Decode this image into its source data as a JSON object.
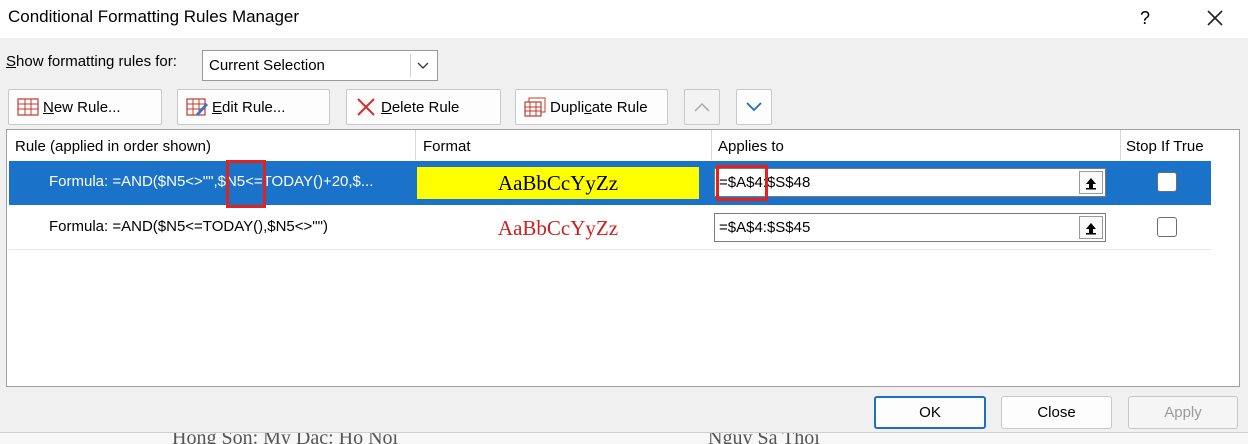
{
  "dialog": {
    "title": "Conditional Formatting Rules Manager",
    "help_label": "?",
    "close_icon": "close-x-icon"
  },
  "show_rules": {
    "label_mnemonic": "S",
    "label_rest": "how formatting rules for:",
    "selected": "Current Selection"
  },
  "toolbar": {
    "new_rule": {
      "pre": "",
      "mn": "N",
      "post": "ew Rule..."
    },
    "edit_rule": {
      "pre": "",
      "mn": "E",
      "post": "dit Rule..."
    },
    "delete_rule": {
      "pre": "",
      "mn": "D",
      "post": "elete Rule"
    },
    "duplicate_rule": {
      "pre": "Dupli",
      "mn": "c",
      "post": "ate Rule"
    },
    "move_up_icon": "chevron-up-icon",
    "move_down_icon": "chevron-down-icon"
  },
  "columns": {
    "rule": "Rule (applied in order shown)",
    "format": "Format",
    "applies_to": "Applies to",
    "stop_if_true": "Stop If True"
  },
  "rules": [
    {
      "rule": "Formula: =AND($N5<>\"\",$N5<=TODAY()+20,$...",
      "preview": "AaBbCcYyZz",
      "preview_bg": "#ffff00",
      "preview_color": "#000000",
      "applies_to": "=$A$4:$S$48",
      "stop_if_true": false,
      "selected": true
    },
    {
      "rule": "Formula: =AND($N5<=TODAY(),$N5<>\"\")",
      "preview": "AaBbCcYyZz",
      "preview_bg": "",
      "preview_color": "#d01f1f",
      "applies_to": "=$A$4:$S$45",
      "stop_if_true": false,
      "selected": false
    }
  ],
  "buttons": {
    "ok": "OK",
    "close": "Close",
    "apply": "Apply"
  },
  "colors": {
    "selection": "#1a73c8",
    "highlight_box": "#e0231f"
  },
  "underlay_fragments": [
    "Hong Son: My Dac: Ho Noi",
    "Nguy Sa Thoi"
  ]
}
